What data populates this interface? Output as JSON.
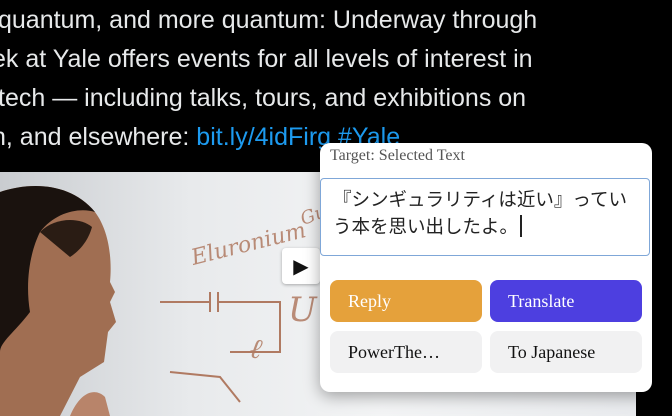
{
  "tweet": {
    "line1": "quantum, and more quantum: Underway through",
    "line2": "ek at Yale offers events for all levels of interest in",
    "line3": "tech — including talks, tours, and exhibitions on",
    "line4_prefix": "n, and elsewhere: ",
    "link_text": "bit.ly/4idFirg",
    "hashtag": "#Yale"
  },
  "media": {
    "play_icon": "▶",
    "board_scribbles": [
      "Eluronium",
      "Gubi",
      "U",
      "ℓ"
    ]
  },
  "popup": {
    "target_label": "Target: Selected Text",
    "input_text": "『シンギュラリティは近い』っていう本を思い出したよ。",
    "buttons": {
      "reply": "Reply",
      "translate": "Translate",
      "power": "PowerThe…",
      "japanese": "To Japanese"
    }
  },
  "colors": {
    "reply": "#e5a13b",
    "translate": "#4d3fe0",
    "link": "#1d9bf0"
  }
}
